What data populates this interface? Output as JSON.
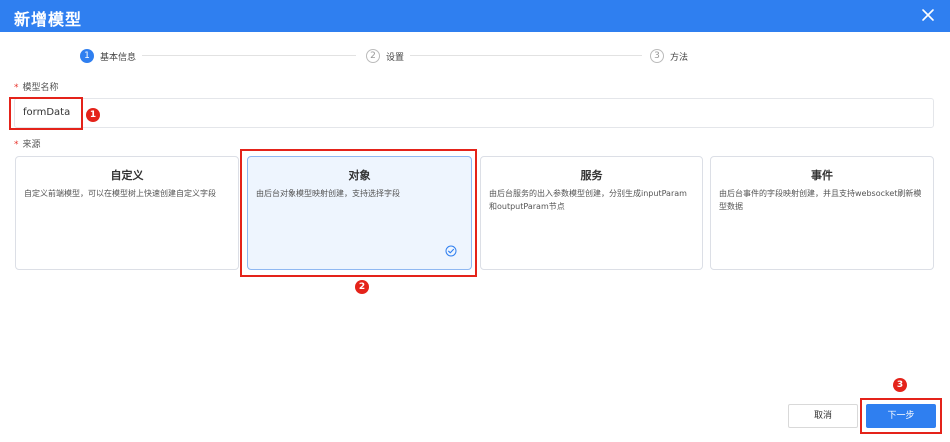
{
  "dialog": {
    "title": "新增模型"
  },
  "steps": [
    {
      "num": "1",
      "label": "基本信息"
    },
    {
      "num": "2",
      "label": "设置"
    },
    {
      "num": "3",
      "label": "方法"
    }
  ],
  "form": {
    "name_label": "模型名称",
    "name_value": "formData",
    "source_label": "来源",
    "required_mark": "*"
  },
  "sources": [
    {
      "title": "自定义",
      "desc": "自定义前端模型，可以在模型树上快速创建自定义字段"
    },
    {
      "title": "对象",
      "desc": "由后台对象模型映射创建，支持选择字段"
    },
    {
      "title": "服务",
      "desc": "由后台服务的出入参数模型创建，分别生成inputParam和outputParam节点"
    },
    {
      "title": "事件",
      "desc": "由后台事件的字段映射创建，并且支持websocket刷新模型数据"
    }
  ],
  "selected_source": "对象",
  "annotations": [
    "1",
    "2",
    "3"
  ],
  "footer": {
    "cancel_label": "取消",
    "next_label": "下一步"
  },
  "colors": {
    "primary": "#2f7ff0",
    "annotation": "#e4231a",
    "selected_bg": "#eef5fe"
  }
}
